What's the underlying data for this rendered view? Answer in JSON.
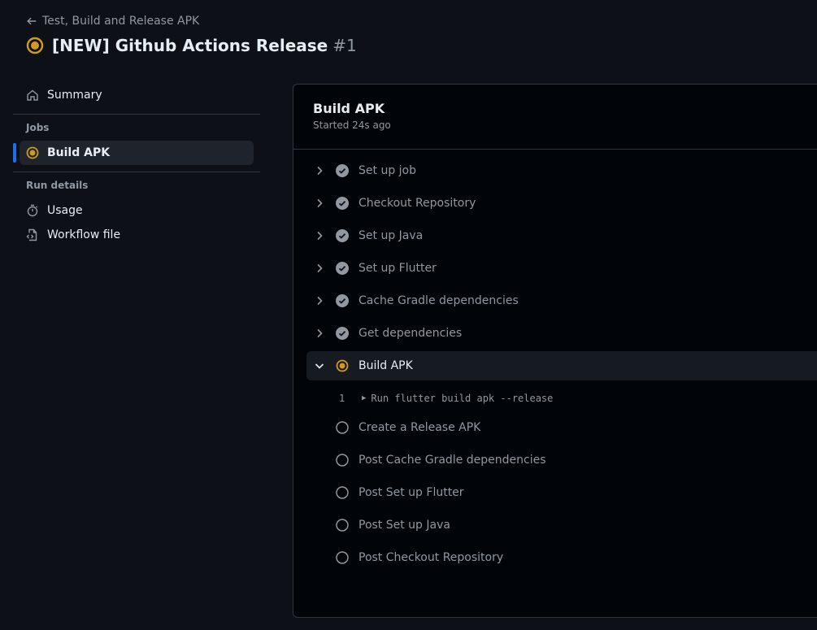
{
  "header": {
    "back_label": "Test, Build and Release APK",
    "title": "[NEW] Github Actions Release",
    "run_number": "#1"
  },
  "sidebar": {
    "summary": "Summary",
    "jobs_heading": "Jobs",
    "jobs": [
      {
        "label": "Build APK",
        "status": "in_progress"
      }
    ],
    "run_details_heading": "Run details",
    "usage": "Usage",
    "workflow_file": "Workflow file"
  },
  "job": {
    "title": "Build APK",
    "started": "Started 24s ago",
    "steps": [
      {
        "label": "Set up job",
        "status": "success"
      },
      {
        "label": "Checkout Repository",
        "status": "success"
      },
      {
        "label": "Set up Java",
        "status": "success"
      },
      {
        "label": "Set up Flutter",
        "status": "success"
      },
      {
        "label": "Cache Gradle dependencies",
        "status": "success"
      },
      {
        "label": "Get dependencies",
        "status": "success"
      },
      {
        "label": "Build APK",
        "status": "in_progress"
      },
      {
        "label": "Create a Release APK",
        "status": "pending"
      },
      {
        "label": "Post Cache Gradle dependencies",
        "status": "pending"
      },
      {
        "label": "Post Set up Flutter",
        "status": "pending"
      },
      {
        "label": "Post Set up Java",
        "status": "pending"
      },
      {
        "label": "Post Checkout Repository",
        "status": "pending"
      }
    ],
    "log": {
      "line_number": "1",
      "text": "Run flutter build apk --release"
    }
  },
  "colors": {
    "accent": "#1f6feb",
    "in_progress": "#d29922",
    "success": "#9198a1"
  }
}
